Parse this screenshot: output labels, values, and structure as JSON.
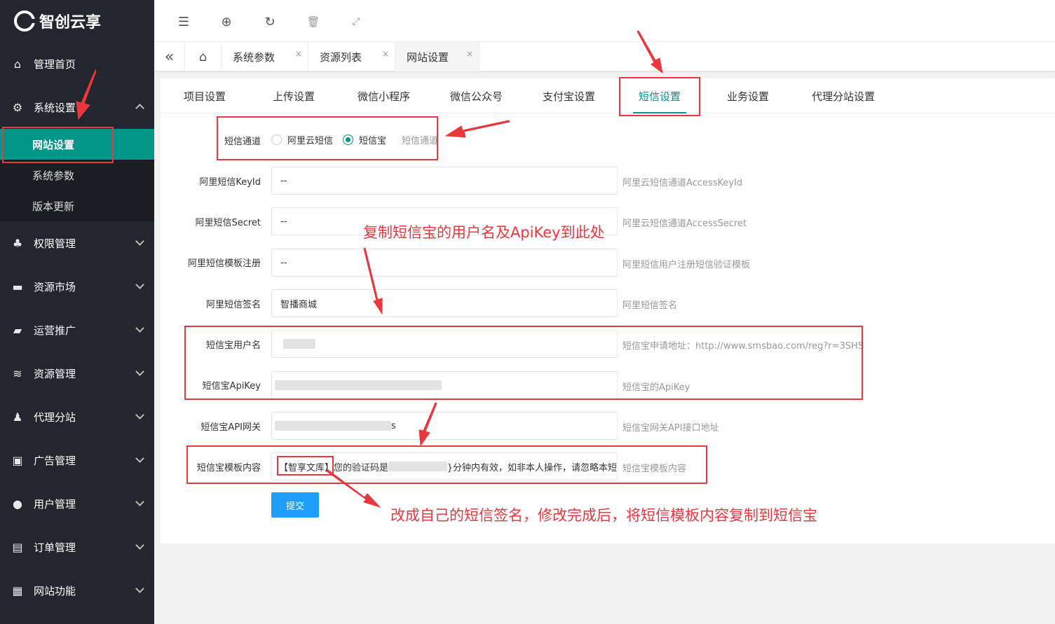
{
  "sidebar": {
    "logo_text": "智创云享",
    "items": [
      {
        "label": "管理首页",
        "icon": "home-icon"
      },
      {
        "label": "系统设置",
        "icon": "gear-icon"
      },
      {
        "label": "权限管理",
        "icon": "permission-icon"
      },
      {
        "label": "资源市场",
        "icon": "market-icon"
      },
      {
        "label": "运营推广",
        "icon": "promotion-icon"
      },
      {
        "label": "资源管理",
        "icon": "layers-icon"
      },
      {
        "label": "代理分站",
        "icon": "agent-icon"
      },
      {
        "label": "广告管理",
        "icon": "ad-icon"
      },
      {
        "label": "用户管理",
        "icon": "user-icon"
      },
      {
        "label": "订单管理",
        "icon": "order-icon"
      },
      {
        "label": "网站功能",
        "icon": "apps-icon"
      }
    ],
    "sub_items": [
      "网站设置",
      "系统参数",
      "版本更新"
    ]
  },
  "header": {
    "tools": [
      "menu-fold-icon",
      "globe-icon",
      "refresh-icon",
      "trash-icon",
      "fullscreen-icon"
    ]
  },
  "tabsbar": {
    "tabs": [
      "系统参数",
      "资源列表",
      "网站设置"
    ],
    "close_glyph": "×"
  },
  "settings_tabs": [
    "项目设置",
    "上传设置",
    "微信小程序",
    "微信公众号",
    "支付宝设置",
    "短信设置",
    "业务设置",
    "代理分站设置"
  ],
  "form": {
    "channel": {
      "label": "短信通道",
      "options": [
        "阿里云短信",
        "短信宝"
      ],
      "selected": "短信宝",
      "hint": "短信通道"
    },
    "ali_key_id": {
      "label": "阿里短信KeyId",
      "value": "--",
      "hint": "阿里云短信通道AccessKeyId"
    },
    "ali_secret": {
      "label": "阿里短信Secret",
      "value": "--",
      "hint": "阿里云短信通道AccessSecret"
    },
    "ali_template": {
      "label": "阿里短信模板注册",
      "value": "--",
      "hint": "阿里短信用户注册短信验证模板"
    },
    "ali_sign": {
      "label": "阿里短信签名",
      "value": "智播商城",
      "hint": "阿里短信签名"
    },
    "smsbao_user": {
      "label": "短信宝用户名",
      "value": "",
      "hint": "短信宝申请地址：http://www.smsbao.com/reg?r=3SHS"
    },
    "smsbao_apikey": {
      "label": "短信宝ApiKey",
      "value": "",
      "hint": "短信宝的ApiKey"
    },
    "smsbao_gateway": {
      "label": "短信宝API网关",
      "value_suffix": "s",
      "hint": "短信宝网关API接口地址"
    },
    "smsbao_template": {
      "label": "短信宝模板内容",
      "value_prefix": "【智享文库】您的验证码是",
      "value_suffix": "}分钟内有效，如非本人操作，请忽略本短",
      "hint": "短信宝模板内容"
    },
    "submit_label": "提交"
  },
  "annotations": {
    "copy_note": "复制短信宝的用户名及ApiKey到此处",
    "sign_note": "改成自己的短信签名，修改完成后，将短信模板内容复制到短信宝"
  },
  "colors": {
    "accent": "#009688",
    "sidebar_bg": "#23262e",
    "annotation": "#e8383d",
    "button": "#1e9fff"
  }
}
